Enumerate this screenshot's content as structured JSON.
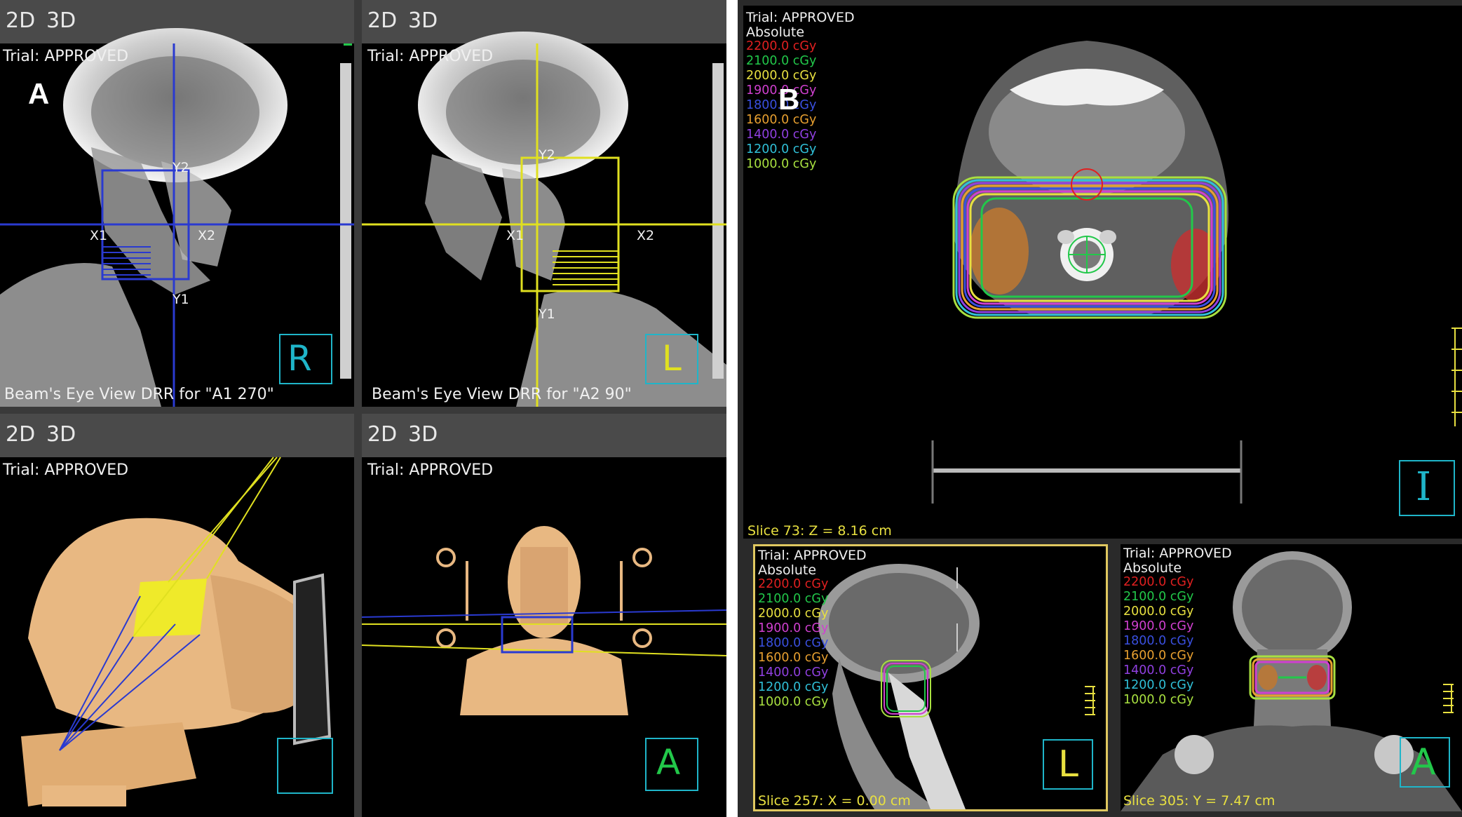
{
  "panel_a": {
    "panel_letter": "A",
    "views": [
      {
        "tab_2d": "2D",
        "tab_3d": "3D",
        "trial": "Trial: APPROVED",
        "caption": "Beam's Eye View DRR for \"A1 270\"",
        "jaw_labels": {
          "x1": "X1",
          "x2": "X2",
          "y1": "Y1",
          "y2": "Y2"
        },
        "orientation": "R"
      },
      {
        "tab_2d": "2D",
        "tab_3d": "3D",
        "trial": "Trial: APPROVED",
        "caption": "Beam's Eye View DRR for \"A2 90\"",
        "jaw_labels": {
          "x1": "X1",
          "x2": "X2",
          "y1": "Y1",
          "y2": "Y2"
        },
        "orientation": "L"
      },
      {
        "tab_2d": "2D",
        "tab_3d": "3D",
        "trial": "Trial: APPROVED",
        "orientation": ""
      },
      {
        "tab_2d": "2D",
        "tab_3d": "3D",
        "trial": "Trial: APPROVED",
        "orientation": "A"
      }
    ]
  },
  "panel_b": {
    "panel_letter": "B",
    "dose_legend": [
      {
        "label": "2200.0 cGy",
        "color": "#e02020"
      },
      {
        "label": "2100.0 cGy",
        "color": "#22c84a"
      },
      {
        "label": "2000.0 cGy",
        "color": "#e8e040"
      },
      {
        "label": "1900.0 cGy",
        "color": "#d040d0"
      },
      {
        "label": "1800.0 cGy",
        "color": "#3a50e0"
      },
      {
        "label": "1600.0 cGy",
        "color": "#e8a030"
      },
      {
        "label": "1400.0 cGy",
        "color": "#9040e0"
      },
      {
        "label": "1200.0 cGy",
        "color": "#30c0d8"
      },
      {
        "label": "1000.0 cGy",
        "color": "#a8e040"
      }
    ],
    "axial": {
      "trial": "Trial: APPROVED",
      "mode": "Absolute",
      "slice": "Slice 73: Z = 8.16 cm",
      "orientation": "I"
    },
    "sagittal": {
      "trial": "Trial: APPROVED",
      "mode": "Absolute",
      "slice": "Slice 257: X = 0.00 cm",
      "orientation": "L"
    },
    "coronal": {
      "trial": "Trial: APPROVED",
      "mode": "Absolute",
      "slice": "Slice 305: Y = 7.47 cm",
      "orientation": "A"
    }
  }
}
